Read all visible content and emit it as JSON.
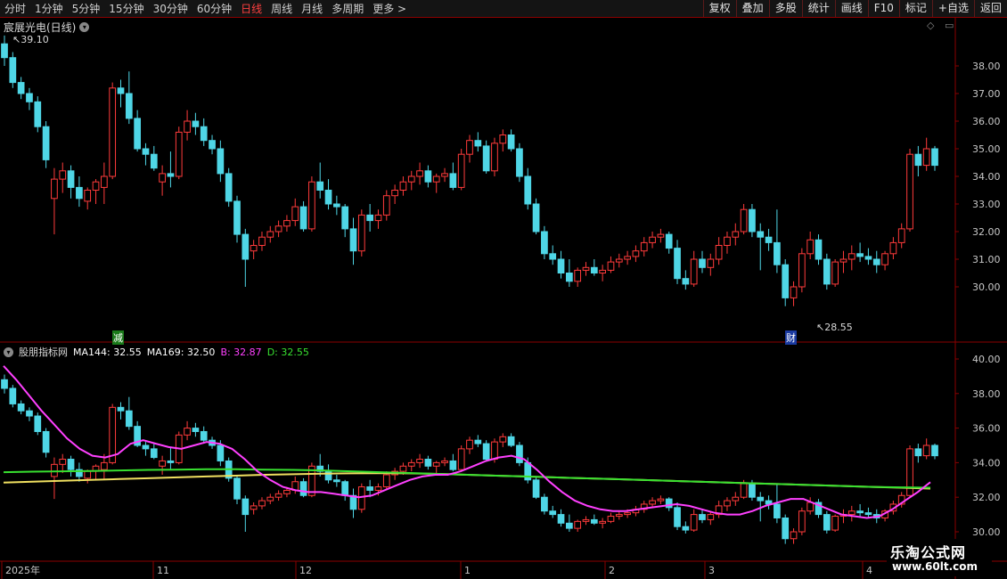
{
  "toolbar": {
    "left_items": [
      "分时",
      "1分钟",
      "5分钟",
      "15分钟",
      "30分钟",
      "60分钟",
      "日线",
      "周线",
      "月线",
      "多周期",
      "更多 >"
    ],
    "active": "日线",
    "right_items": [
      "复权",
      "叠加",
      "多股",
      "统计",
      "画线",
      "F10",
      "标记",
      "+自选",
      "返回"
    ]
  },
  "header": {
    "stock_title": "宸展光电(日线)"
  },
  "main_chart": {
    "y_ticks": [
      "38.00",
      "37.00",
      "36.00",
      "35.00",
      "34.00",
      "33.00",
      "32.00",
      "31.00",
      "30.00"
    ],
    "high_label": "39.10",
    "low_label": "28.55",
    "marker_jian": "减",
    "marker_cai": "财"
  },
  "indicator": {
    "name": "股朋指标网",
    "ma144": "MA144: 32.55",
    "ma169": "MA169: 32.50",
    "b": "B: 32.87",
    "d": "D: 32.55",
    "y_ticks": [
      "40.00",
      "38.00",
      "36.00",
      "34.00",
      "32.00",
      "30.00"
    ]
  },
  "x_axis": {
    "labels": [
      "2025年",
      "11",
      "12",
      "1",
      "2",
      "3",
      "4"
    ]
  },
  "watermark": {
    "brand": "乐淘公式网",
    "url": "www.60lt.com"
  },
  "colors": {
    "up": "#ff3b3b",
    "down": "#4fd6e6",
    "ma144": "#38e030",
    "ma169": "#f0e060",
    "b": "#ff40ff",
    "d": "#38e030"
  },
  "chart_data": {
    "type": "candlestick",
    "y_range": [
      29.5,
      39.3
    ],
    "ohlc": [
      [
        38.8,
        39.1,
        38.0,
        38.3
      ],
      [
        38.3,
        38.5,
        37.2,
        37.4
      ],
      [
        37.4,
        37.6,
        36.8,
        37.0
      ],
      [
        37.0,
        37.2,
        36.4,
        36.7
      ],
      [
        36.7,
        36.9,
        35.6,
        35.8
      ],
      [
        35.8,
        36.0,
        34.3,
        34.6
      ],
      [
        33.2,
        34.3,
        31.9,
        33.9
      ],
      [
        33.9,
        34.5,
        33.4,
        34.2
      ],
      [
        34.2,
        34.4,
        33.2,
        33.6
      ],
      [
        33.6,
        34.0,
        32.9,
        33.2
      ],
      [
        33.1,
        33.6,
        32.8,
        33.5
      ],
      [
        33.5,
        33.9,
        33.0,
        33.8
      ],
      [
        33.6,
        34.5,
        33.0,
        34.0
      ],
      [
        34.0,
        37.4,
        33.9,
        37.2
      ],
      [
        37.2,
        37.5,
        36.5,
        37.0
      ],
      [
        37.0,
        37.8,
        35.9,
        36.1
      ],
      [
        36.1,
        36.4,
        34.9,
        35.0
      ],
      [
        35.0,
        35.2,
        34.4,
        34.8
      ],
      [
        34.8,
        35.1,
        34.2,
        34.3
      ],
      [
        33.8,
        34.4,
        33.3,
        34.1
      ],
      [
        34.1,
        34.9,
        33.6,
        34.0
      ],
      [
        34.0,
        35.8,
        33.9,
        35.6
      ],
      [
        35.6,
        36.4,
        35.3,
        36.0
      ],
      [
        36.0,
        36.3,
        35.5,
        35.8
      ],
      [
        35.8,
        36.1,
        35.1,
        35.3
      ],
      [
        35.3,
        35.5,
        34.8,
        35.0
      ],
      [
        35.0,
        35.3,
        33.8,
        34.1
      ],
      [
        34.1,
        34.3,
        32.9,
        33.1
      ],
      [
        33.1,
        33.3,
        31.6,
        31.9
      ],
      [
        31.9,
        32.1,
        30.0,
        31.0
      ],
      [
        31.3,
        31.7,
        31.0,
        31.5
      ],
      [
        31.5,
        32.0,
        31.3,
        31.8
      ],
      [
        31.8,
        32.2,
        31.6,
        32.0
      ],
      [
        32.0,
        32.4,
        31.8,
        32.2
      ],
      [
        32.2,
        32.6,
        32.0,
        32.4
      ],
      [
        32.4,
        33.2,
        32.2,
        32.9
      ],
      [
        32.9,
        33.1,
        32.0,
        32.1
      ],
      [
        32.1,
        34.0,
        32.0,
        33.8
      ],
      [
        33.8,
        34.5,
        33.2,
        33.5
      ],
      [
        33.5,
        33.9,
        32.8,
        33.0
      ],
      [
        33.0,
        33.3,
        32.6,
        32.9
      ],
      [
        32.9,
        33.0,
        31.8,
        32.1
      ],
      [
        32.1,
        32.5,
        30.8,
        31.3
      ],
      [
        31.3,
        32.8,
        31.1,
        32.6
      ],
      [
        32.6,
        33.0,
        32.0,
        32.4
      ],
      [
        32.4,
        32.8,
        32.1,
        32.6
      ],
      [
        32.6,
        33.5,
        32.4,
        33.3
      ],
      [
        33.3,
        33.7,
        33.0,
        33.5
      ],
      [
        33.5,
        34.0,
        33.3,
        33.8
      ],
      [
        33.8,
        34.2,
        33.5,
        34.0
      ],
      [
        34.0,
        34.5,
        33.7,
        34.2
      ],
      [
        34.2,
        34.4,
        33.6,
        33.8
      ],
      [
        33.8,
        34.1,
        33.4,
        34.0
      ],
      [
        34.0,
        34.3,
        33.8,
        34.1
      ],
      [
        34.1,
        34.5,
        33.5,
        33.6
      ],
      [
        33.6,
        35.0,
        33.5,
        34.8
      ],
      [
        34.8,
        35.5,
        34.5,
        35.3
      ],
      [
        35.3,
        35.6,
        34.9,
        35.1
      ],
      [
        35.1,
        35.3,
        34.1,
        34.2
      ],
      [
        34.2,
        35.4,
        34.0,
        35.2
      ],
      [
        35.2,
        35.7,
        34.9,
        35.5
      ],
      [
        35.5,
        35.7,
        34.9,
        35.0
      ],
      [
        35.0,
        35.2,
        33.8,
        34.0
      ],
      [
        34.0,
        34.3,
        32.8,
        33.0
      ],
      [
        33.0,
        33.2,
        31.9,
        32.0
      ],
      [
        32.0,
        32.2,
        31.0,
        31.2
      ],
      [
        31.2,
        31.5,
        30.8,
        31.0
      ],
      [
        31.0,
        31.3,
        30.3,
        30.5
      ],
      [
        30.5,
        31.0,
        30.0,
        30.2
      ],
      [
        30.2,
        30.7,
        30.0,
        30.6
      ],
      [
        30.6,
        30.9,
        30.4,
        30.7
      ],
      [
        30.7,
        31.0,
        30.4,
        30.5
      ],
      [
        30.5,
        30.8,
        30.2,
        30.6
      ],
      [
        30.6,
        31.1,
        30.5,
        30.9
      ],
      [
        30.9,
        31.2,
        30.7,
        31.0
      ],
      [
        31.0,
        31.3,
        30.8,
        31.1
      ],
      [
        31.1,
        31.5,
        30.9,
        31.3
      ],
      [
        31.3,
        31.8,
        31.1,
        31.6
      ],
      [
        31.6,
        32.0,
        31.4,
        31.8
      ],
      [
        31.8,
        32.1,
        31.6,
        31.9
      ],
      [
        31.9,
        32.0,
        31.2,
        31.4
      ],
      [
        31.4,
        31.7,
        30.1,
        30.3
      ],
      [
        30.3,
        30.6,
        29.9,
        30.1
      ],
      [
        30.1,
        31.3,
        30.0,
        31.0
      ],
      [
        31.0,
        31.3,
        30.5,
        30.7
      ],
      [
        30.7,
        31.2,
        30.4,
        31.0
      ],
      [
        31.0,
        31.8,
        30.8,
        31.5
      ],
      [
        31.5,
        32.0,
        31.2,
        31.8
      ],
      [
        31.8,
        32.3,
        31.5,
        32.0
      ],
      [
        32.0,
        33.0,
        31.9,
        32.8
      ],
      [
        32.8,
        33.0,
        31.8,
        32.0
      ],
      [
        32.0,
        32.3,
        30.6,
        31.8
      ],
      [
        31.8,
        32.1,
        31.3,
        31.6
      ],
      [
        31.6,
        32.8,
        30.5,
        30.8
      ],
      [
        30.8,
        31.0,
        29.3,
        29.6
      ],
      [
        29.6,
        30.2,
        29.3,
        30.0
      ],
      [
        30.0,
        31.4,
        29.8,
        31.2
      ],
      [
        31.2,
        32.0,
        31.0,
        31.7
      ],
      [
        31.7,
        31.9,
        30.8,
        31.0
      ],
      [
        31.0,
        31.2,
        29.9,
        30.1
      ],
      [
        30.1,
        31.0,
        30.0,
        30.9
      ],
      [
        30.9,
        31.3,
        30.5,
        31.0
      ],
      [
        31.0,
        31.5,
        30.6,
        31.2
      ],
      [
        31.2,
        31.6,
        30.9,
        31.1
      ],
      [
        31.1,
        31.4,
        30.8,
        31.0
      ],
      [
        31.0,
        31.3,
        30.5,
        30.8
      ],
      [
        30.8,
        31.3,
        30.6,
        31.2
      ],
      [
        31.2,
        31.8,
        31.0,
        31.6
      ],
      [
        31.6,
        32.3,
        31.4,
        32.1
      ],
      [
        32.1,
        35.0,
        32.0,
        34.8
      ],
      [
        34.8,
        35.1,
        34.0,
        34.4
      ],
      [
        34.4,
        35.4,
        34.2,
        35.0
      ],
      [
        35.0,
        35.1,
        34.2,
        34.4
      ]
    ],
    "ma144": [
      33.45,
      33.48,
      33.5,
      33.52,
      33.55,
      33.58,
      33.6,
      33.62,
      33.62,
      33.6,
      33.58,
      33.55,
      33.5,
      33.45,
      33.4,
      33.35,
      33.3,
      33.25,
      33.2,
      33.15,
      33.1,
      33.05,
      33.0,
      32.95,
      32.9,
      32.85,
      32.8,
      32.75,
      32.7,
      32.65,
      32.6,
      32.57,
      32.55
    ],
    "ma169": [
      32.85,
      32.9,
      32.95,
      33.0,
      33.05,
      33.1,
      33.15,
      33.2,
      33.25,
      33.3,
      33.33,
      33.36,
      33.38,
      33.39,
      33.38,
      33.35,
      33.3,
      33.25,
      33.2,
      33.15,
      33.1,
      33.05,
      33.0,
      32.95,
      32.9,
      32.85,
      32.8,
      32.75,
      32.7,
      32.65,
      32.6,
      32.55,
      32.5
    ],
    "b_line": [
      39.6,
      38.8,
      37.9,
      37.0,
      36.2,
      35.4,
      34.8,
      34.4,
      34.3,
      34.5,
      35.1,
      35.3,
      35.1,
      34.9,
      34.8,
      35.0,
      35.2,
      35.1,
      34.8,
      34.2,
      33.5,
      33.0,
      32.6,
      32.4,
      32.3,
      32.3,
      32.2,
      32.1,
      32.0,
      32.1,
      32.4,
      32.7,
      33.0,
      33.2,
      33.3,
      33.3,
      33.5,
      33.8,
      34.1,
      34.3,
      34.4,
      34.2,
      33.6,
      32.9,
      32.3,
      31.8,
      31.5,
      31.3,
      31.2,
      31.2,
      31.3,
      31.4,
      31.5,
      31.6,
      31.5,
      31.3,
      31.1,
      31.0,
      31.0,
      31.2,
      31.5,
      31.7,
      31.9,
      31.9,
      31.6,
      31.3,
      31.0,
      30.9,
      30.8,
      30.9,
      31.3,
      31.8,
      32.3,
      32.87
    ],
    "d_line_end": 32.55
  }
}
